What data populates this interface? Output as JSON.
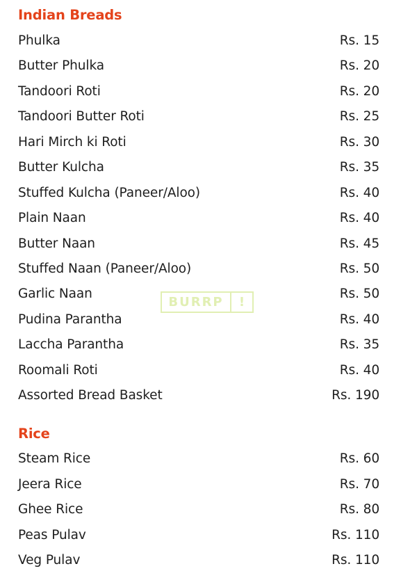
{
  "sections": [
    {
      "title": "Indian Breads",
      "items": [
        {
          "name": "Phulka",
          "price": "Rs. 15"
        },
        {
          "name": "Butter Phulka",
          "price": "Rs. 20"
        },
        {
          "name": "Tandoori Roti",
          "price": "Rs. 20"
        },
        {
          "name": "Tandoori Butter Roti",
          "price": "Rs. 25"
        },
        {
          "name": "Hari Mirch ki Roti",
          "price": "Rs. 30"
        },
        {
          "name": "Butter Kulcha",
          "price": "Rs. 35"
        },
        {
          "name": "Stuffed Kulcha (Paneer/Aloo)",
          "price": "Rs. 40"
        },
        {
          "name": "Plain Naan",
          "price": "Rs. 40"
        },
        {
          "name": "Butter Naan",
          "price": "Rs. 45"
        },
        {
          "name": "Stuffed Naan (Paneer/Aloo)",
          "price": "Rs. 50"
        },
        {
          "name": "Garlic Naan",
          "price": "Rs. 50"
        },
        {
          "name": "Pudina Parantha",
          "price": "Rs. 40"
        },
        {
          "name": "Laccha Parantha",
          "price": "Rs. 35"
        },
        {
          "name": "Roomali Roti",
          "price": "Rs. 40"
        },
        {
          "name": "Assorted Bread Basket",
          "price": "Rs. 190"
        }
      ]
    },
    {
      "title": "Rice",
      "items": [
        {
          "name": "Steam Rice",
          "price": "Rs. 60"
        },
        {
          "name": "Jeera Rice",
          "price": "Rs. 70"
        },
        {
          "name": "Ghee Rice",
          "price": "Rs. 80"
        },
        {
          "name": "Peas Pulav",
          "price": "Rs. 110"
        },
        {
          "name": "Veg Pulav",
          "price": "Rs. 110"
        }
      ]
    }
  ],
  "watermark": {
    "text": "BURRP",
    "mark": "!"
  },
  "colors": {
    "heading": "#e4431b",
    "text": "#1e1e1e",
    "watermark": "#d8ea9a"
  }
}
